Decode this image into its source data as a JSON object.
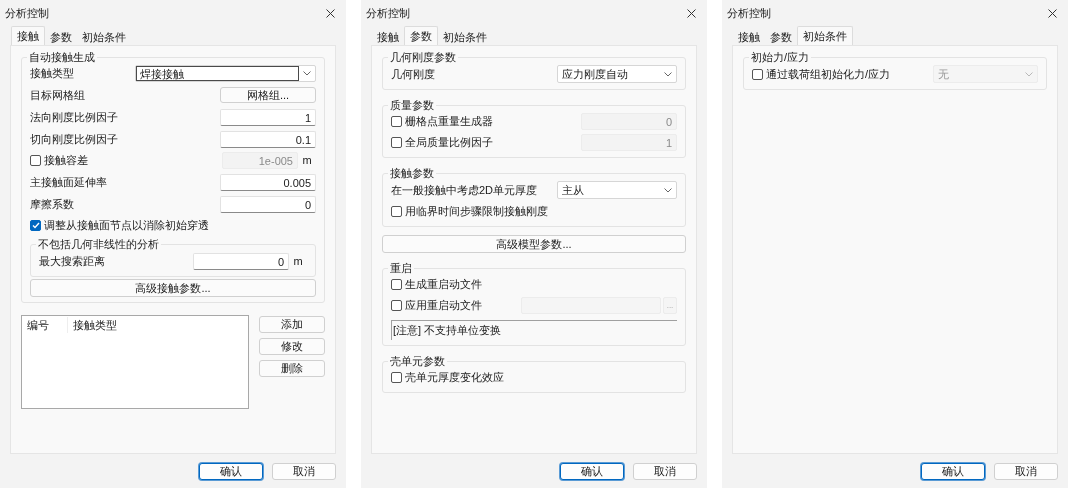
{
  "dialogs": [
    {
      "title": "分析控制",
      "tabs": [
        {
          "label": "接触",
          "selected": true
        },
        {
          "label": "参数",
          "selected": false
        },
        {
          "label": "初始条件",
          "selected": false
        }
      ],
      "panel": [
        {
          "kind": "group",
          "title": "自动接触生成",
          "rows": [
            {
              "kind": "combo",
              "label": "接触类型",
              "value": "焊接接触"
            },
            {
              "kind": "button_row",
              "label": "目标网格组",
              "button": "网格组..."
            },
            {
              "kind": "number",
              "label": "法向刚度比例因子",
              "value": "1"
            },
            {
              "kind": "number",
              "label": "切向刚度比例因子",
              "value": "0.1"
            },
            {
              "kind": "check_number",
              "label": "接触容差",
              "checked": false,
              "value": "1e-005",
              "unit": "m"
            },
            {
              "kind": "number",
              "label": "主接触面延伸率",
              "value": "0.005"
            },
            {
              "kind": "number",
              "label": "摩擦系数",
              "value": "0"
            },
            {
              "kind": "check",
              "label": "调整从接触面节点以消除初始穿透",
              "checked": true
            },
            {
              "kind": "group",
              "title": "不包括几何非线性的分析",
              "rows": [
                {
                  "kind": "number",
                  "label": "最大搜索距离",
                  "value": "0",
                  "unit": "m"
                }
              ]
            },
            {
              "kind": "wide_button",
              "label": "高级接触参数..."
            }
          ]
        },
        {
          "kind": "list",
          "columns": [
            "编号",
            "接触类型"
          ],
          "buttons": [
            "添加",
            "修改",
            "删除"
          ]
        }
      ],
      "buttons": [
        {
          "label": "确认",
          "default": true
        },
        {
          "label": "取消",
          "default": false
        }
      ]
    },
    {
      "title": "分析控制",
      "tabs": [
        {
          "label": "接触",
          "selected": false
        },
        {
          "label": "参数",
          "selected": true
        },
        {
          "label": "初始条件",
          "selected": false
        }
      ],
      "panel": [
        {
          "kind": "group",
          "title": "几何刚度参数",
          "rows": [
            {
              "kind": "select",
              "label": "几何刚度",
              "value": "应力刚度自动"
            }
          ]
        },
        {
          "kind": "group",
          "title": "质量参数",
          "rows": [
            {
              "kind": "check_number",
              "label": "栅格点重量生成器",
              "checked": false,
              "value": "0"
            },
            {
              "kind": "check_number",
              "label": "全局质量比例因子",
              "checked": false,
              "value": "1"
            }
          ]
        },
        {
          "kind": "group",
          "title": "接触参数",
          "rows": [
            {
              "kind": "select",
              "label": "在一般接触中考虑2D单元厚度",
              "value": "主从"
            },
            {
              "kind": "check",
              "label": "用临界时间步骤限制接触刚度",
              "checked": false
            }
          ]
        },
        {
          "kind": "wide_button",
          "label": "高级模型参数..."
        },
        {
          "kind": "group",
          "title": "重启",
          "rows": [
            {
              "kind": "check",
              "label": "生成重启动文件",
              "checked": false
            },
            {
              "kind": "check_file",
              "label": "应用重启动文件",
              "checked": false,
              "browse": "..."
            },
            {
              "kind": "note",
              "text": "[注意] 不支持单位变换"
            }
          ]
        },
        {
          "kind": "group",
          "title": "壳单元参数",
          "rows": [
            {
              "kind": "check",
              "label": "壳单元厚度变化效应",
              "checked": false
            }
          ]
        }
      ],
      "buttons": [
        {
          "label": "确认",
          "default": true
        },
        {
          "label": "取消",
          "default": false
        }
      ]
    },
    {
      "title": "分析控制",
      "tabs": [
        {
          "label": "接触",
          "selected": false
        },
        {
          "label": "参数",
          "selected": false
        },
        {
          "label": "初始条件",
          "selected": true
        }
      ],
      "panel": [
        {
          "kind": "group",
          "title": "初始力/应力",
          "rows": [
            {
              "kind": "check_select",
              "label": "通过载荷组初始化力/应力",
              "checked": false,
              "value": "无"
            }
          ]
        }
      ],
      "buttons": [
        {
          "label": "确认",
          "default": true
        },
        {
          "label": "取消",
          "default": false
        }
      ]
    }
  ]
}
